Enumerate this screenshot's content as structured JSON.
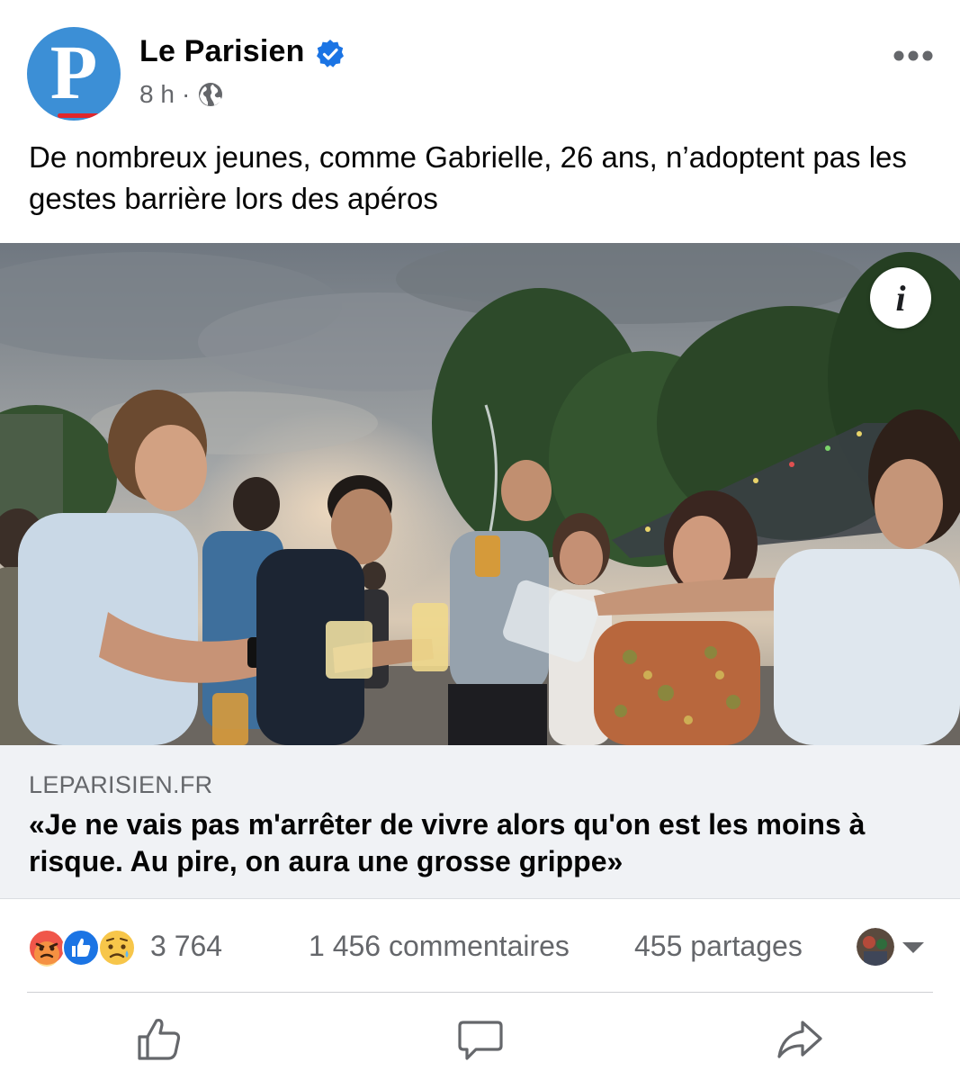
{
  "post": {
    "page_name": "Le Parisien",
    "avatar_letter": "P",
    "time": "8 h",
    "separator": "·",
    "caption": "De nombreux jeunes, comme Gabrielle, 26 ans, n’adoptent pas les gestes barrière lors des apéros"
  },
  "link": {
    "info_icon_label": "i",
    "domain": "LEPARISIEN.FR",
    "headline": "«Je ne vais pas m'arrêter de vivre alors qu'on est les moins à risque. Au pire, on aura une grosse grippe»"
  },
  "stats": {
    "reactions": [
      "angry-icon",
      "like-icon",
      "sad-icon"
    ],
    "reaction_count": "3 764",
    "comments": "1 456 commentaires",
    "shares": "455 partages"
  },
  "actions": [
    "like-icon",
    "comment-icon",
    "share-icon"
  ],
  "colors": {
    "brand_blue": "#3c8fd6",
    "verified_blue": "#1b74e4",
    "secondary_text": "#65676b",
    "link_background": "#f0f2f5"
  }
}
